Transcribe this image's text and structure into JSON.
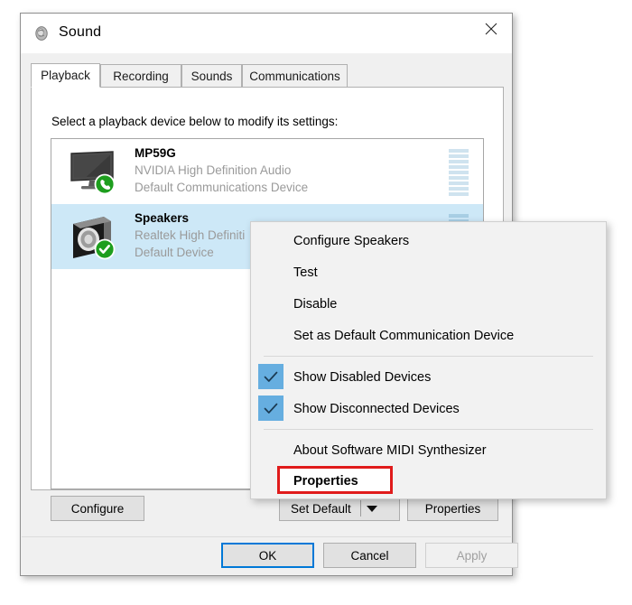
{
  "window": {
    "title": "Sound",
    "title_icon": "speaker-icon",
    "close_label": "Close"
  },
  "tabs": [
    {
      "label": "Playback",
      "active": true
    },
    {
      "label": "Recording",
      "active": false
    },
    {
      "label": "Sounds",
      "active": false
    },
    {
      "label": "Communications",
      "active": false
    }
  ],
  "instruction": "Select a playback device below to modify its settings:",
  "devices": [
    {
      "name": "MP59G",
      "driver": "NVIDIA High Definition Audio",
      "status": "Default Communications Device",
      "icon": "monitor-icon",
      "badge": "green-phone-badge",
      "selected": false,
      "meter_segments": 9,
      "meter_active": 0
    },
    {
      "name": "Speakers",
      "driver": "Realtek High Definiti",
      "status": "Default Device",
      "icon": "speaker-box-icon",
      "badge": "green-check-badge",
      "selected": true,
      "meter_segments": 9,
      "meter_active": 0
    }
  ],
  "device_buttons": {
    "configure": "Configure",
    "set_default": "Set Default",
    "set_default_arrow": "chevron-down-icon",
    "properties": "Properties"
  },
  "footer_buttons": {
    "ok": "OK",
    "cancel": "Cancel",
    "apply": "Apply",
    "apply_disabled": true,
    "ok_default": true
  },
  "context_menu": {
    "items": [
      {
        "label": "Configure Speakers",
        "checked": false,
        "bold": false,
        "highlighted": false
      },
      {
        "label": "Test",
        "checked": false,
        "bold": false,
        "highlighted": false
      },
      {
        "label": "Disable",
        "checked": false,
        "bold": false,
        "highlighted": false
      },
      {
        "label": "Set as Default Communication Device",
        "checked": false,
        "bold": false,
        "highlighted": false
      },
      {
        "separator": true
      },
      {
        "label": "Show Disabled Devices",
        "checked": true,
        "bold": false,
        "highlighted": false
      },
      {
        "label": "Show Disconnected Devices",
        "checked": true,
        "bold": false,
        "highlighted": false
      },
      {
        "separator": true
      },
      {
        "label": "About Software MIDI Synthesizer",
        "checked": false,
        "bold": false,
        "highlighted": false
      },
      {
        "label": "Properties",
        "checked": false,
        "bold": true,
        "highlighted": true
      }
    ]
  },
  "colors": {
    "selection_blue": "#cde8f7",
    "check_highlight_blue": "#66aee0",
    "accent_focus": "#0078d7",
    "annotation_red": "#e01b1b",
    "badge_green": "#21a121",
    "meter_blue": "#a8cee4"
  }
}
